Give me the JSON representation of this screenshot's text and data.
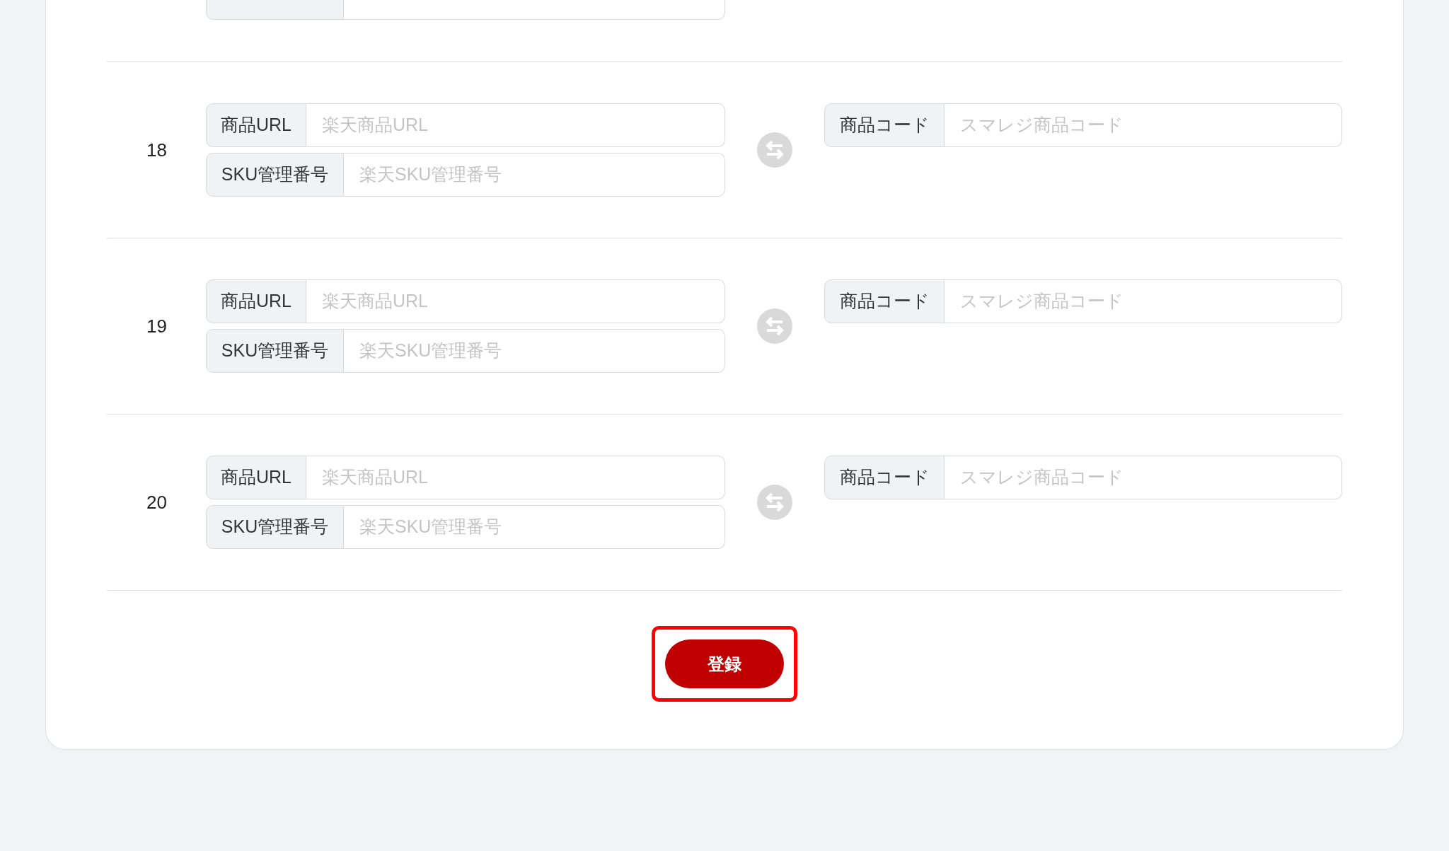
{
  "rows": [
    {
      "number": "18",
      "url_label": "商品URL",
      "url_placeholder": "楽天商品URL",
      "sku_label": "SKU管理番号",
      "sku_placeholder": "楽天SKU管理番号",
      "code_label": "商品コード",
      "code_placeholder": "スマレジ商品コード"
    },
    {
      "number": "19",
      "url_label": "商品URL",
      "url_placeholder": "楽天商品URL",
      "sku_label": "SKU管理番号",
      "sku_placeholder": "楽天SKU管理番号",
      "code_label": "商品コード",
      "code_placeholder": "スマレジ商品コード"
    },
    {
      "number": "20",
      "url_label": "商品URL",
      "url_placeholder": "楽天商品URL",
      "sku_label": "SKU管理番号",
      "sku_placeholder": "楽天SKU管理番号",
      "code_label": "商品コード",
      "code_placeholder": "スマレジ商品コード"
    }
  ],
  "submit_button": {
    "label": "登録",
    "highlighted": true
  }
}
